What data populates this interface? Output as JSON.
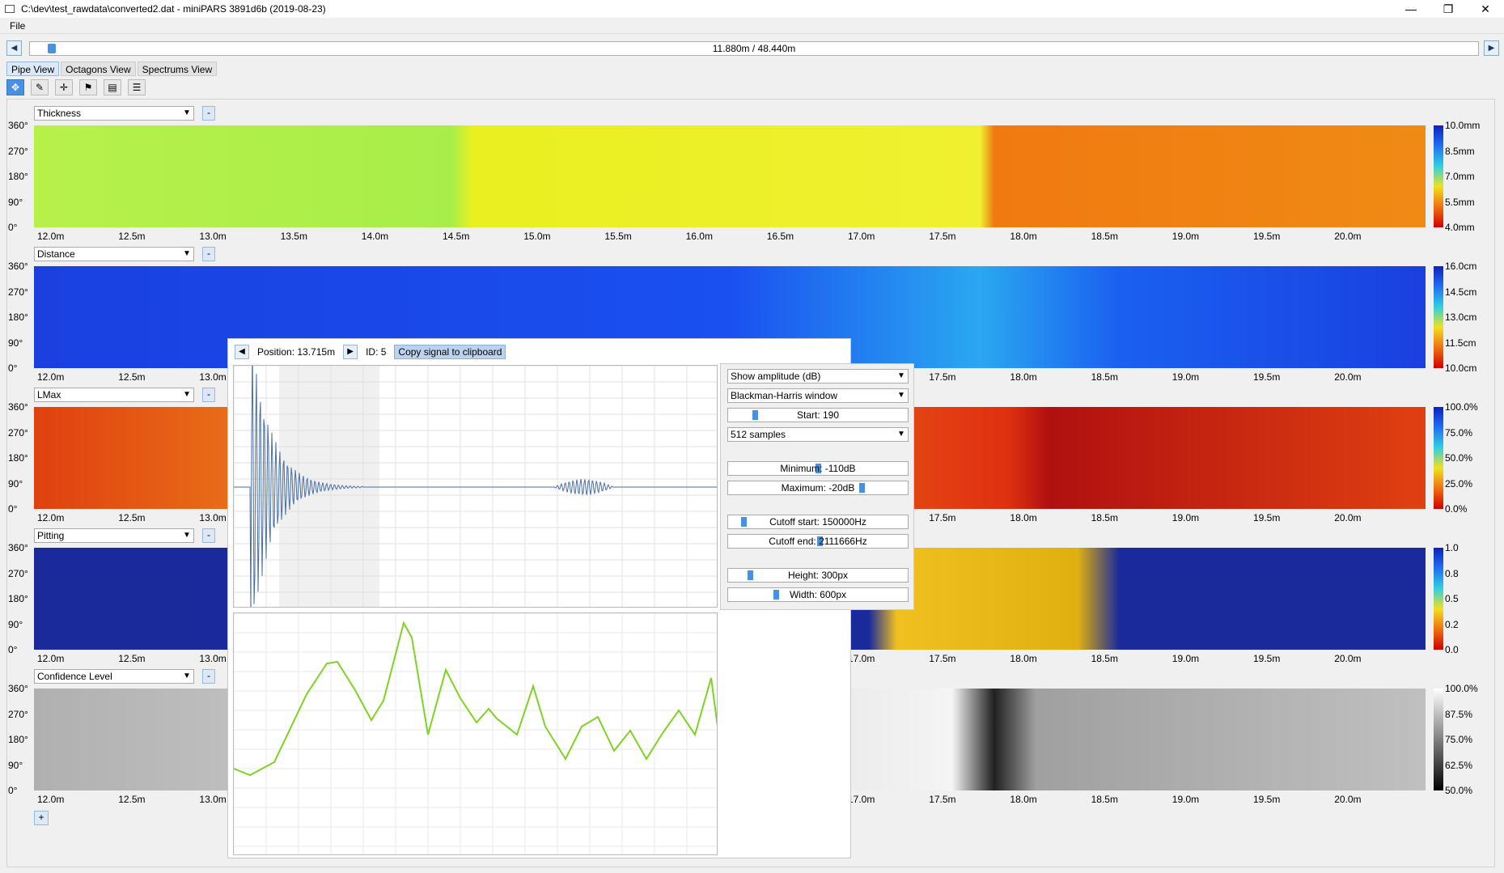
{
  "window": {
    "title": "C:\\dev\\test_rawdata\\converted2.dat - miniPARS 3891d6b (2019-08-23)",
    "minimize": "—",
    "restore": "❐",
    "close": "✕"
  },
  "menu": {
    "file": "File"
  },
  "nav": {
    "position": "11.880m / 48.440m",
    "prev": "◀",
    "next": "▶"
  },
  "tabs": [
    "Pipe View",
    "Octagons View",
    "Spectrums View"
  ],
  "toolbar": {
    "icons": [
      "move-icon",
      "draw-icon",
      "crosshair-icon",
      "flag-icon",
      "document-icon",
      "settings-icon"
    ]
  },
  "yticks": [
    "360°",
    "270°",
    "180°",
    "90°",
    "0°"
  ],
  "xticks": [
    "12.0m",
    "12.5m",
    "13.0m",
    "13.5m",
    "14.0m",
    "14.5m",
    "15.0m",
    "15.5m",
    "16.0m",
    "16.5m",
    "17.0m",
    "17.5m",
    "18.0m",
    "18.5m",
    "19.0m",
    "19.5m",
    "20.0m"
  ],
  "panels": [
    {
      "type": "Thickness",
      "colorbar": [
        "10.0mm",
        "8.5mm",
        "7.0mm",
        "5.5mm",
        "4.0mm"
      ]
    },
    {
      "type": "Distance",
      "colorbar": [
        "16.0cm",
        "14.5cm",
        "13.0cm",
        "11.5cm",
        "10.0cm"
      ]
    },
    {
      "type": "LMax",
      "colorbar": [
        "100.0%",
        "75.0%",
        "50.0%",
        "25.0%",
        "0.0%"
      ]
    },
    {
      "type": "Pitting",
      "colorbar": [
        "1.0",
        "0.8",
        "0.5",
        "0.2",
        "0.0"
      ]
    },
    {
      "type": "Confidence Level",
      "colorbar": [
        "100.0%",
        "87.5%",
        "75.0%",
        "62.5%",
        "50.0%"
      ]
    }
  ],
  "panel_minus": "-",
  "add_panel": "+",
  "popup": {
    "prev": "◀",
    "next": "▶",
    "position": "Position: 13.715m",
    "id": "ID: 5",
    "copy": "Copy signal to clipboard",
    "controls": {
      "mode": "Show amplitude (dB)",
      "window": "Blackman-Harris window",
      "start": "Start: 190",
      "samples": "512 samples",
      "minimum": "Minimum: -110dB",
      "maximum": "Maximum: -20dB",
      "cutoff_start": "Cutoff start: 150000Hz",
      "cutoff_end": "Cutoff end: 2111666Hz",
      "height": "Height: 300px",
      "width": "Width: 600px"
    }
  },
  "colors": {
    "accent": "#4a90e2",
    "signal": "#4a6fa5",
    "spectrum": "#7ed321"
  }
}
